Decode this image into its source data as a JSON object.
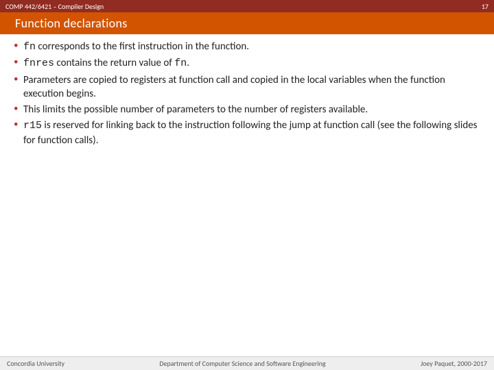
{
  "top": {
    "course": "COMP 442/6421 – Compiler Design",
    "pageno": "17"
  },
  "title": "Function declarations",
  "bullets": {
    "b1_code": "fn",
    "b1_rest": " corresponds to the first instruction in the function.",
    "b2_code1": "fnres",
    "b2_mid": " contains the return value of ",
    "b2_code2": "fn",
    "b2_end": ".",
    "b3": "Parameters are copied to registers at function call and copied in the local variables when the function execution begins.",
    "b4": "This limits the possible number of parameters to the number of registers available.",
    "b5_code": "r15",
    "b5_rest": " is reserved for linking back to the instruction following the jump at function call (see the following slides for function calls)."
  },
  "footer": {
    "left": "Concordia University",
    "center": "Department of Computer Science and Software Engineering",
    "right": "Joey Paquet, 2000-2017"
  }
}
